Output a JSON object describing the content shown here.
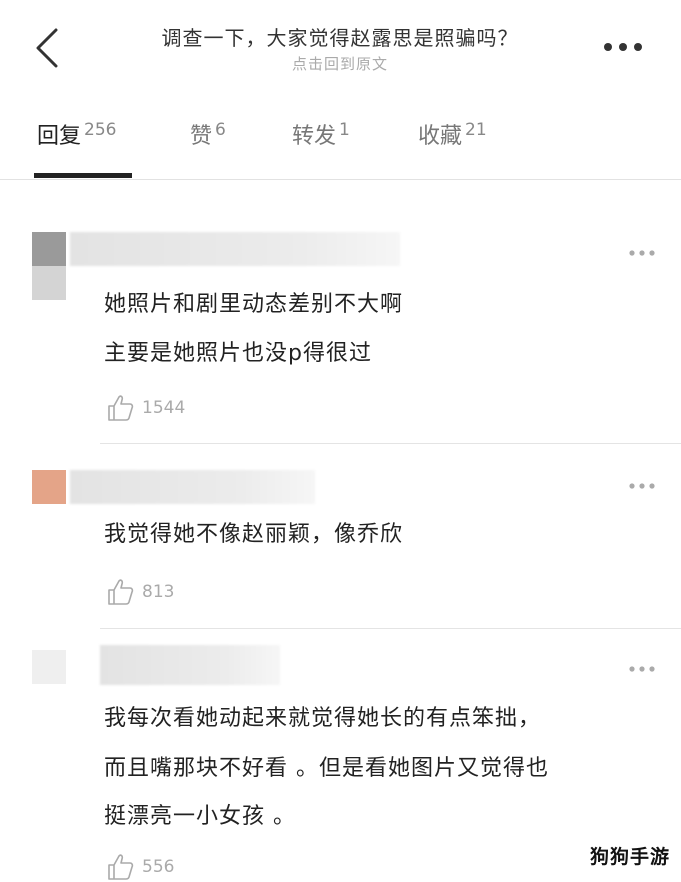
{
  "header": {
    "title": "调查一下，大家觉得赵露思是照骗吗？",
    "subtitle": "点击回到原文",
    "back_icon": "back-chevron-icon",
    "more_icon": "more-dots-icon"
  },
  "tabs": [
    {
      "label": "回复",
      "count": "256",
      "active": true
    },
    {
      "label": "赞",
      "count": "6",
      "active": false
    },
    {
      "label": "转发",
      "count": "1",
      "active": false
    },
    {
      "label": "收藏",
      "count": "21",
      "active": false
    }
  ],
  "comments": [
    {
      "lines": [
        "她照片和剧里动态差别不大啊",
        "主要是她照片也没p得很过"
      ],
      "likes": "1544",
      "avatar_color": "#9a9a9a"
    },
    {
      "lines": [
        "我觉得她不像赵丽颖，像乔欣"
      ],
      "likes": "813",
      "avatar_color": "#e4a488"
    },
    {
      "lines": [
        "我每次看她动起来就觉得她长的有点笨拙，",
        "而且嘴那块不好看 。但是看她图片又觉得也",
        "挺漂亮一小女孩 。"
      ],
      "likes": "556",
      "avatar_color": "#e8e8e8"
    }
  ],
  "watermark": "狗狗手游",
  "colors": {
    "text": "#222222",
    "muted": "#aaaaaa",
    "indicator": "#222222"
  }
}
